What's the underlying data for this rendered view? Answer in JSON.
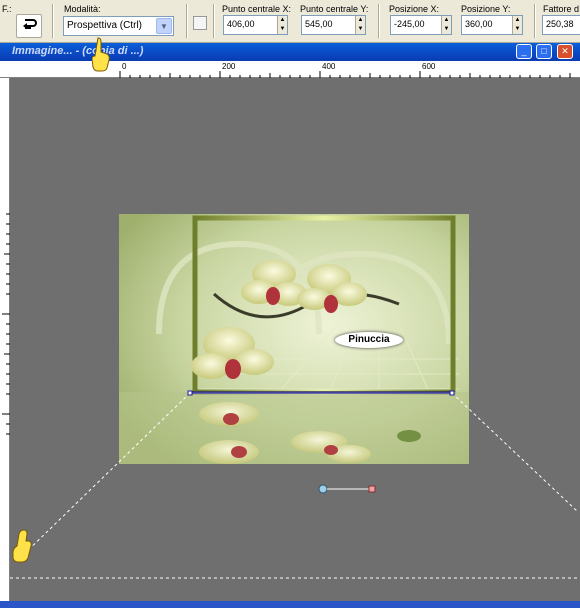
{
  "toolbar": {
    "first_label": "F.:",
    "mode_label": "Modalità:",
    "mode_value": "Prospettiva (Ctrl)",
    "center_x_label": "Punto centrale X:",
    "center_x_value": "406,00",
    "center_y_label": "Punto centrale Y:",
    "center_y_value": "545,00",
    "pos_x_label": "Posizione X:",
    "pos_x_value": "-245,00",
    "pos_y_label": "Posizione Y:",
    "pos_y_value": "360,00",
    "factor_label": "Fattore d",
    "factor_value": "250,38"
  },
  "window": {
    "title": "Immagine... - (copia di ...)"
  },
  "ruler": {
    "ticks": [
      "0",
      "200",
      "400",
      "600"
    ]
  },
  "watermark": {
    "text": "Pinuccia"
  },
  "colors": {
    "canvas_bg": "#6f6f6f",
    "title_blue": "#0a47c2",
    "photo_green": "#c8d6a0"
  }
}
